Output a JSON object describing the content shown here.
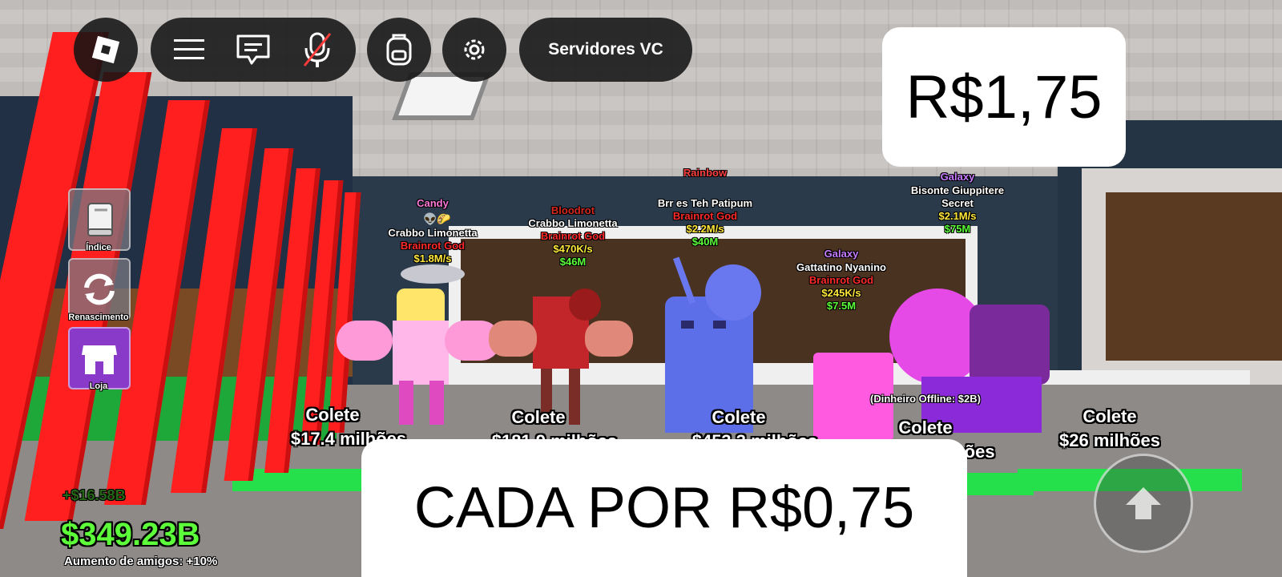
{
  "topbar": {
    "servers_label": "Servidores VC"
  },
  "side_menu": [
    {
      "label": "Índice",
      "icon": "book-icon"
    },
    {
      "label": "Renascimento",
      "icon": "refresh-icon"
    },
    {
      "label": "Loja",
      "icon": "shop-icon"
    }
  ],
  "overlays": {
    "price_total": "R$1,75",
    "price_each": "CADA POR R$0,75"
  },
  "money": {
    "gain": "+$16.58B",
    "total": "$349.23B",
    "friends_boost": "Aumento de amigos: +10%"
  },
  "brainrots": [
    {
      "mutation": "Candy",
      "name": "Crabbo Limonetta",
      "rarity": "Brainrot God",
      "rate": "$1.8M/s",
      "price": "",
      "collect_label": "Colete",
      "collect_amount": "$17.4 milhões"
    },
    {
      "mutation": "Bloodrot",
      "name": "Crabbo Limonetta",
      "rarity": "Brainrot God",
      "rate": "$470K/s",
      "price": "$46M",
      "collect_label": "Colete",
      "collect_amount": "$181.9 milhões"
    },
    {
      "mutation": "Rainbow",
      "name": "Brr es Teh Patipum",
      "rarity": "Brainrot God",
      "rate": "$2.2M/s",
      "price": "$40M",
      "collect_label": "Colete",
      "collect_amount": "$453.3 milhões"
    },
    {
      "mutation": "Galaxy",
      "name": "Gattatino Nyanino",
      "rarity": "Brainrot God",
      "rate": "$245K/s",
      "price": "$7.5M",
      "collect_label": "Colete",
      "collect_amount": "milhões"
    },
    {
      "mutation": "Galaxy",
      "name": "Bisonte Giuppitere",
      "rarity": "Secret",
      "rate": "$2.1M/s",
      "price": "$75M",
      "collect_label": "Colete",
      "collect_amount": "$26 milhões"
    }
  ],
  "offline_money": "(Dinheiro Offline: $2B)",
  "colors": {
    "money_green": "#5cff3a",
    "rate_yellow": "#ffe83a",
    "rarity_red": "#ff2a2a",
    "candy_pink": "#ff7ad9",
    "bloodrot_red": "#d6281f",
    "galaxy_purple": "#c87cff"
  }
}
